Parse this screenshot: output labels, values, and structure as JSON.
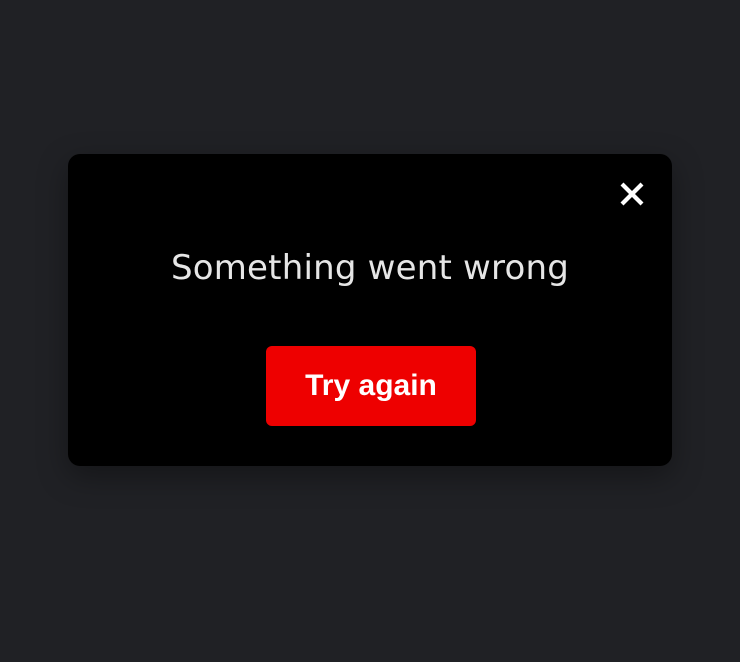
{
  "dialog": {
    "message": "Something went wrong",
    "retry_label": "Try again",
    "close_icon": "close-icon"
  },
  "colors": {
    "page_background": "#202125",
    "dialog_background": "#000000",
    "message_text": "#e6e6e6",
    "button_background": "#ee0000",
    "button_text": "#ffffff",
    "close_icon": "#ffffff"
  }
}
